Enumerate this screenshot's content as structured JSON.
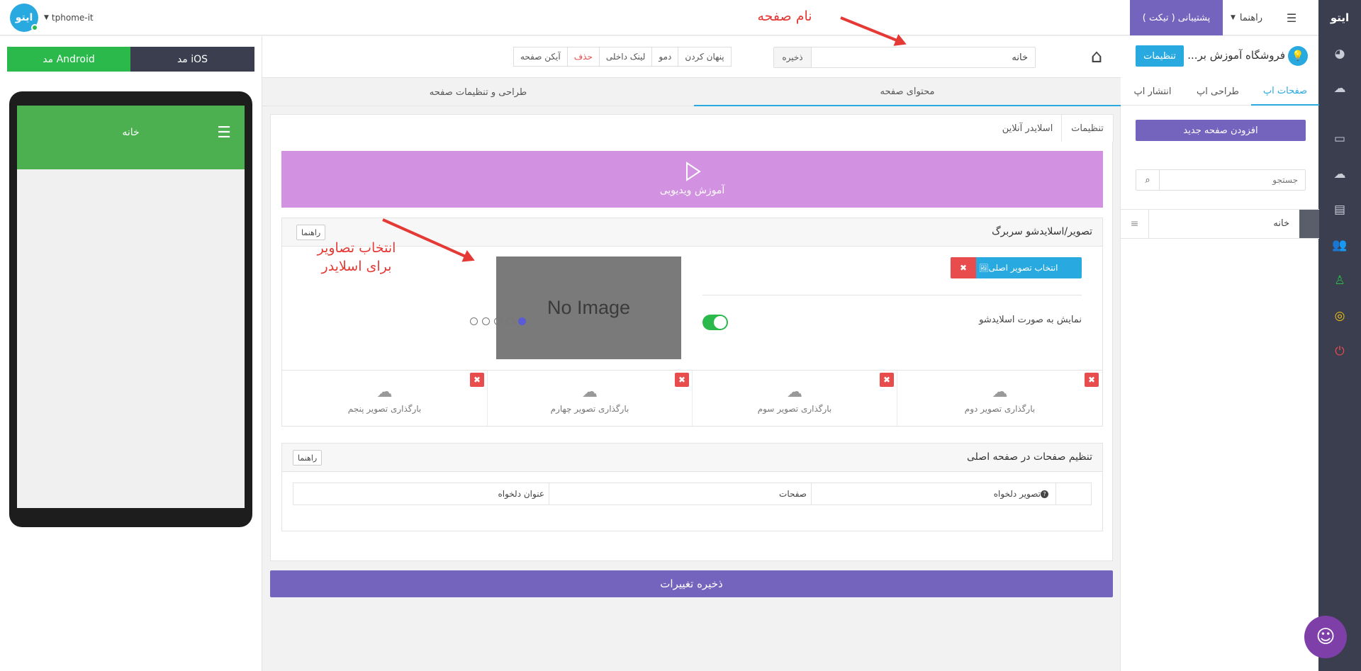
{
  "topbar": {
    "logo": "ایتو",
    "user_label": "tphome-it",
    "support_label": "پشتیبانی ( تیکت )",
    "guide_label": "راهنما"
  },
  "annotations": {
    "page_name": "نام صفحه",
    "select_images_line1": "انتخاب تصاویر",
    "select_images_line2": "برای اسلایدر"
  },
  "app_panel": {
    "title": "فروشگاه آموزش بر...",
    "settings_button": "تنظیمات",
    "tabs": [
      "صفحات اپ",
      "طراحی اپ",
      "انتشار اپ"
    ],
    "add_page_button": "افزودن صفحه جدید",
    "search_placeholder": "جستجو",
    "pages": [
      {
        "label": "خانه"
      }
    ]
  },
  "editor": {
    "page_name_value": "خانه",
    "save_label": "ذخیره",
    "toolbar": {
      "hide": "پنهان کردن",
      "demo": "دمو",
      "internal_link": "لینک داخلی",
      "delete": "حذف",
      "page_icon": "آیکن صفحه"
    },
    "main_tabs": [
      "محتوای صفحه",
      "طراحی و تنظیمات صفحه"
    ],
    "sub_tabs": [
      "تنظیمات",
      "اسلایدر آنلاین"
    ],
    "video_banner": "آموزش ویدیویی",
    "header_panel": {
      "title": "تصویر/اسلایدشو سربرگ",
      "help": "راهنما",
      "select_main_image": "انتخاب تصویر اصلی",
      "slideshow_toggle_label": "نمایش به صورت اسلایدشو",
      "slideshow_enabled": true,
      "no_image": "No Image",
      "uploads": [
        "بارگذاری تصویر دوم",
        "بارگذاری تصویر سوم",
        "بارگذاری تصویر چهارم",
        "بارگذاری تصویر پنجم"
      ]
    },
    "pages_panel": {
      "title": "تنظیم صفحات در صفحه اصلی",
      "help": "راهنما",
      "columns": [
        "تصویر دلخواه",
        "صفحات",
        "عنوان دلخواه"
      ]
    },
    "save_changes": "ذخیره تغییرات"
  },
  "preview": {
    "ios_label": "مد iOS",
    "android_label": "مد Android",
    "screen_title": "خانه"
  },
  "colors": {
    "purple": "#7464be",
    "green": "#2ab94a",
    "blue": "#28a9e0",
    "red": "#e84c4c",
    "rail": "#3a3e4e"
  }
}
